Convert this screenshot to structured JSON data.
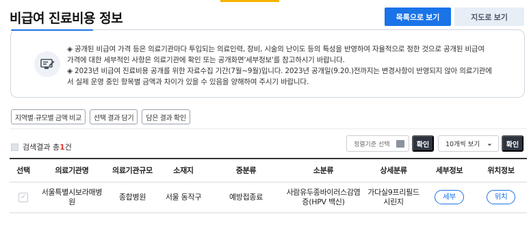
{
  "page": {
    "title": "비급여 진료비용 정보"
  },
  "view_buttons": {
    "list": "목록으로 보기",
    "map": "지도로 보기"
  },
  "notice": {
    "line1": "◈ 공개된 비급여 가격 등은 의료기관마다 투입되는 의료인력, 장비, 시술의 난이도 등의 특성을 반영하여 자율적으로 정한 것으로 공개된 비급여",
    "line2": "가격에 대한 세부적인 사항은 의료기관에 확인 또는 공개화면'세부정보'를 참고하시기 바랍니다.",
    "line3": "◈ 2023년 비급여 진료비용 공개를 위한 자료수집 기간(7월~9월)입니다. 2023년 공개일(9.20.)전까지는 변경사항이 반영되지 않아 의료기관에",
    "line4": "서 실제 운영 중인 항목별 금액과 차이가 있을 수 있음을 양해하여 주시기 바랍니다."
  },
  "filters": [
    "지역별·규모별 금액 비교",
    "선택 결과 담기",
    "담은 결과 확인"
  ],
  "result": {
    "prefix": "검색결과 총",
    "count": "1",
    "suffix": "건"
  },
  "controls": {
    "sort_label": "정렬기준 선택",
    "confirm": "확인",
    "per_page": "10개씩 보기"
  },
  "table": {
    "headers": [
      "선택",
      "의료기관명",
      "의료기관규모",
      "소재지",
      "중분류",
      "소분류",
      "상세분류",
      "세부정보",
      "위치정보"
    ],
    "rows": [
      {
        "checkbox": "✓",
        "name": "서울특별시보라매병원",
        "scale": "종합병원",
        "location": "서울 동작구",
        "mid": "예방접종료",
        "sub": "사람유두종바이러스감염증(HPV 백신)",
        "detail": "가다실9프리필드시린지",
        "detail_btn": "세부",
        "location_btn": "위치"
      }
    ]
  },
  "colors": {
    "accent": "#1a73e8",
    "highlight": "#f5b400",
    "dark": "#2d3440",
    "count": "#e0352b"
  }
}
